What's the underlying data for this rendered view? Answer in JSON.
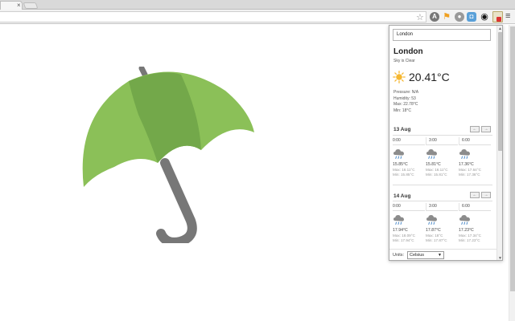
{
  "browser": {
    "tab_close_glyph": "×",
    "star_glyph": "☆",
    "menu_glyph": "≡",
    "extensions": [
      "translate-icon",
      "bookmark-flag-icon",
      "extension-gray-icon",
      "camera-icon",
      "eye-icon",
      "calendar-weather-icon"
    ]
  },
  "popup": {
    "search_value": "London",
    "city": "London",
    "description": "Sky is Clear",
    "temperature": "20.41°C",
    "pressure": "Pressure: N/A",
    "humidity": "Humidity: 53",
    "max": "Max: 22.78°C",
    "min": "Min: 18°C",
    "nav_prev": "←",
    "nav_next": "→",
    "days": [
      {
        "date": "13 Aug",
        "slots": [
          {
            "time": "0:00",
            "temp": "15.85°C",
            "max": "Max: 16.11°C",
            "min": "Min: 15.85°C"
          },
          {
            "time": "3:00",
            "temp": "15.81°C",
            "max": "Max: 16.11°C",
            "min": "Min: 15.81°C"
          },
          {
            "time": "6:00",
            "temp": "17.36°C",
            "max": "Max: 17.64°C",
            "min": "Min: 17.36°C"
          }
        ]
      },
      {
        "date": "14 Aug",
        "slots": [
          {
            "time": "0:00",
            "temp": "17.94°C",
            "max": "Max: 18.09°C",
            "min": "Min: 17.94°C"
          },
          {
            "time": "3:00",
            "temp": "17.87°C",
            "max": "Max: 18°C",
            "min": "Min: 17.87°C"
          },
          {
            "time": "6:00",
            "temp": "17.23°C",
            "max": "Max: 17.34°C",
            "min": "Min: 17.23°C"
          }
        ]
      }
    ],
    "units_label": "Units:",
    "units_value": "Celsius",
    "units_caret": "▼",
    "scroll_up": "▲",
    "scroll_down": "▼"
  },
  "colors": {
    "umbrella_light": "#8bc058",
    "umbrella_dark": "#73a84a",
    "umbrella_handle": "#777777",
    "sun": "#f5b731"
  }
}
